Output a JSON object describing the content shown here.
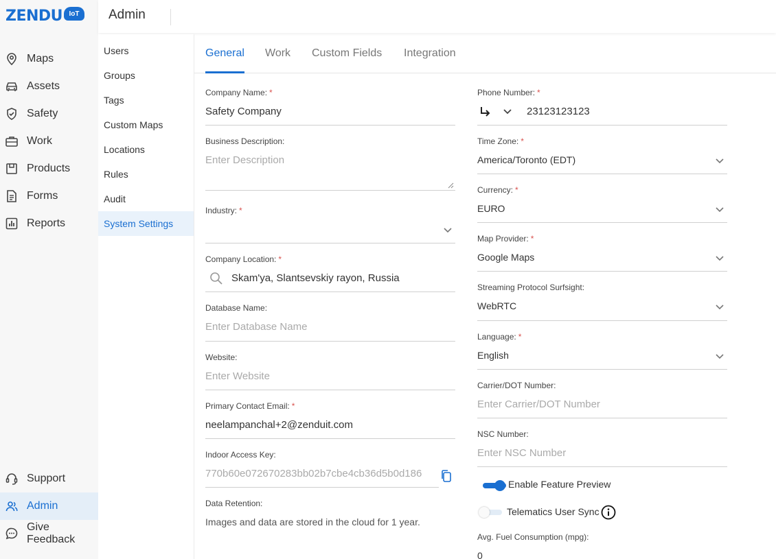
{
  "brand": {
    "logo_text": "ZENDU",
    "logo_badge": "IoT"
  },
  "header": {
    "title": "Admin"
  },
  "nav": {
    "top": [
      {
        "label": "Maps",
        "icon": "map-pin-icon"
      },
      {
        "label": "Assets",
        "icon": "car-icon"
      },
      {
        "label": "Safety",
        "icon": "shield-check-icon"
      },
      {
        "label": "Work",
        "icon": "briefcase-icon"
      },
      {
        "label": "Products",
        "icon": "box-icon"
      },
      {
        "label": "Forms",
        "icon": "document-icon"
      },
      {
        "label": "Reports",
        "icon": "bar-chart-icon"
      }
    ],
    "bottom": [
      {
        "label": "Support",
        "icon": "headset-icon"
      },
      {
        "label": "Admin",
        "icon": "users-icon",
        "active": true
      },
      {
        "label": "Give Feedback",
        "icon": "chat-icon"
      }
    ]
  },
  "subnav": [
    "Users",
    "Groups",
    "Tags",
    "Custom Maps",
    "Locations",
    "Rules",
    "Audit",
    "System Settings"
  ],
  "subnav_active": "System Settings",
  "tabs": [
    "General",
    "Work",
    "Custom Fields",
    "Integration"
  ],
  "active_tab": "General",
  "left": {
    "company_name": {
      "label": "Company Name:",
      "value": "Safety Company"
    },
    "business_description": {
      "label": "Business Description:",
      "placeholder": "Enter Description"
    },
    "industry": {
      "label": "Industry:",
      "value": ""
    },
    "company_location": {
      "label": "Company Location:",
      "value": "Skam'ya, Slantsevskiy rayon, Russia"
    },
    "database_name": {
      "label": "Database Name:",
      "placeholder": "Enter Database Name"
    },
    "website": {
      "label": "Website:",
      "placeholder": "Enter Website"
    },
    "primary_email": {
      "label": "Primary Contact Email:",
      "value": "neelampanchal+2@zenduit.com"
    },
    "indoor_key": {
      "label": "Indoor Access Key:",
      "value": "770b60e072670283bb02b7cbe4cb36d5b0d186"
    },
    "data_retention": {
      "label": "Data Retention:",
      "value": "Images and data are stored in the cloud for 1 year."
    }
  },
  "right": {
    "phone": {
      "label": "Phone Number:",
      "value": "23123123123"
    },
    "time_zone": {
      "label": "Time Zone:",
      "value": "America/Toronto (EDT)"
    },
    "currency": {
      "label": "Currency:",
      "value": "EURO"
    },
    "map_provider": {
      "label": "Map Provider:",
      "value": "Google Maps"
    },
    "streaming": {
      "label": "Streaming Protocol Surfsight:",
      "value": "WebRTC"
    },
    "language": {
      "label": "Language:",
      "value": "English"
    },
    "carrier_dot": {
      "label": "Carrier/DOT Number:",
      "placeholder": "Enter Carrier/DOT Number"
    },
    "nsc": {
      "label": "NSC Number:",
      "placeholder": "Enter NSC Number"
    },
    "feature_preview": {
      "label": "Enable Feature Preview",
      "on": true
    },
    "telematics_sync": {
      "label": "Telematics User Sync",
      "on": false
    },
    "fuel": {
      "label": "Avg. Fuel Consumption (mpg):",
      "value": "0"
    }
  },
  "colors": {
    "accent": "#1a6fd1",
    "required": "#d9534f",
    "nav_bg": "#f7f7f7",
    "active_bg": "#e4eef8"
  }
}
